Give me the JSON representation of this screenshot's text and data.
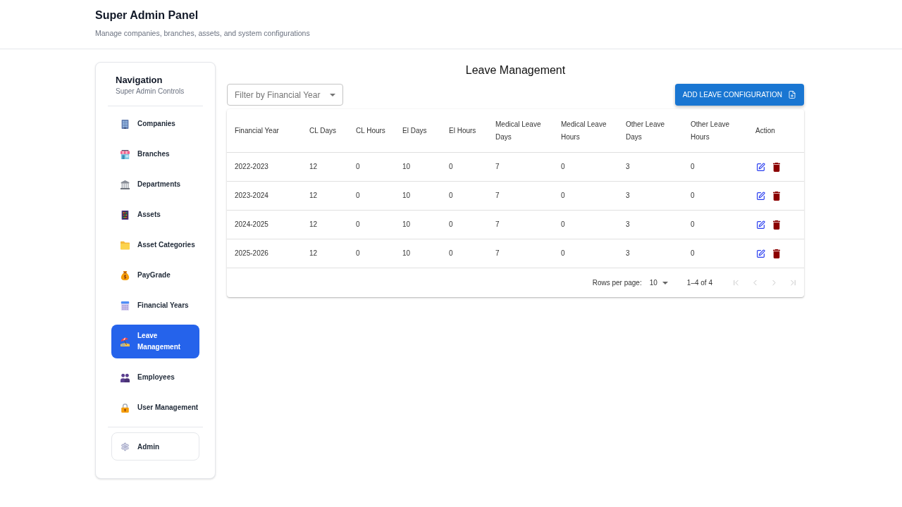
{
  "header": {
    "title": "Super Admin Panel",
    "subtitle": "Manage companies, branches, assets, and system configurations"
  },
  "sidebar": {
    "title": "Navigation",
    "subtitle": "Super Admin Controls",
    "items": [
      {
        "label": "Companies",
        "selected": false
      },
      {
        "label": "Branches",
        "selected": false
      },
      {
        "label": "Departments",
        "selected": false
      },
      {
        "label": "Assets",
        "selected": false
      },
      {
        "label": "Asset Categories",
        "selected": false
      },
      {
        "label": "PayGrade",
        "selected": false
      },
      {
        "label": "Financial Years",
        "selected": false
      },
      {
        "label": "Leave Management",
        "selected": true
      },
      {
        "label": "Employees",
        "selected": false
      },
      {
        "label": "User Management",
        "selected": false
      }
    ],
    "footer_item": {
      "label": "Admin"
    }
  },
  "main": {
    "title": "Leave Management",
    "filter": {
      "placeholder": "Filter by Financial Year"
    },
    "add_button": {
      "label": "ADD LEAVE CONFIGURATION"
    },
    "table": {
      "columns": [
        "Financial Year",
        "CL Days",
        "CL Hours",
        "El Days",
        "El Hours",
        "Medical Leave Days",
        "Medical Leave Hours",
        "Other Leave Days",
        "Other Leave Hours",
        "Action"
      ],
      "rows": [
        {
          "cells": [
            "2022-2023",
            "12",
            "0",
            "10",
            "0",
            "7",
            "0",
            "3",
            "0"
          ]
        },
        {
          "cells": [
            "2023-2024",
            "12",
            "0",
            "10",
            "0",
            "7",
            "0",
            "3",
            "0"
          ]
        },
        {
          "cells": [
            "2024-2025",
            "12",
            "0",
            "10",
            "0",
            "7",
            "0",
            "3",
            "0"
          ]
        },
        {
          "cells": [
            "2025-2026",
            "12",
            "0",
            "10",
            "0",
            "7",
            "0",
            "3",
            "0"
          ]
        }
      ]
    },
    "pagination": {
      "rows_per_page_label": "Rows per page:",
      "rows_per_page": "10",
      "range": "1–4 of 4",
      "nav_buttons": [
        {
          "kind": "first",
          "disabled": true
        },
        {
          "kind": "previous",
          "disabled": true
        },
        {
          "kind": "next",
          "disabled": true
        },
        {
          "kind": "last",
          "disabled": true
        }
      ]
    }
  }
}
